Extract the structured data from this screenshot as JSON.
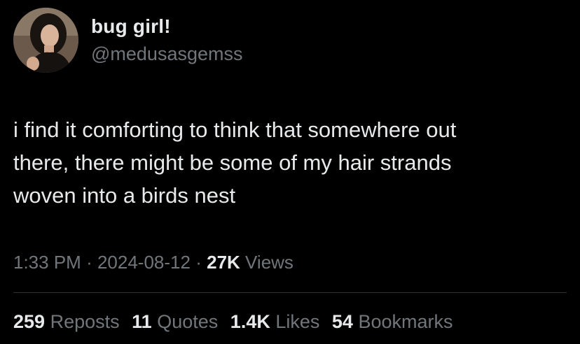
{
  "author": {
    "display_name": "bug girl!",
    "handle": "@medusasgemss",
    "avatar_icon": "profile-photo"
  },
  "tweet": {
    "lines": [
      "i find it comforting to think that somewhere out",
      "there, there might be some of my hair strands",
      "woven into a birds nest"
    ]
  },
  "meta": {
    "time": "1:33 PM",
    "sep": "·",
    "date": "2024-08-12",
    "views_count": "27K",
    "views_label": "Views"
  },
  "stats": {
    "reposts": {
      "count": "259",
      "label": "Reposts"
    },
    "quotes": {
      "count": "11",
      "label": "Quotes"
    },
    "likes": {
      "count": "1.4K",
      "label": "Likes"
    },
    "bookmarks": {
      "count": "54",
      "label": "Bookmarks"
    }
  },
  "colors": {
    "background": "#000000",
    "primary_text": "#e7e9ea",
    "secondary_text": "#71767b",
    "divider": "#2f3336"
  }
}
